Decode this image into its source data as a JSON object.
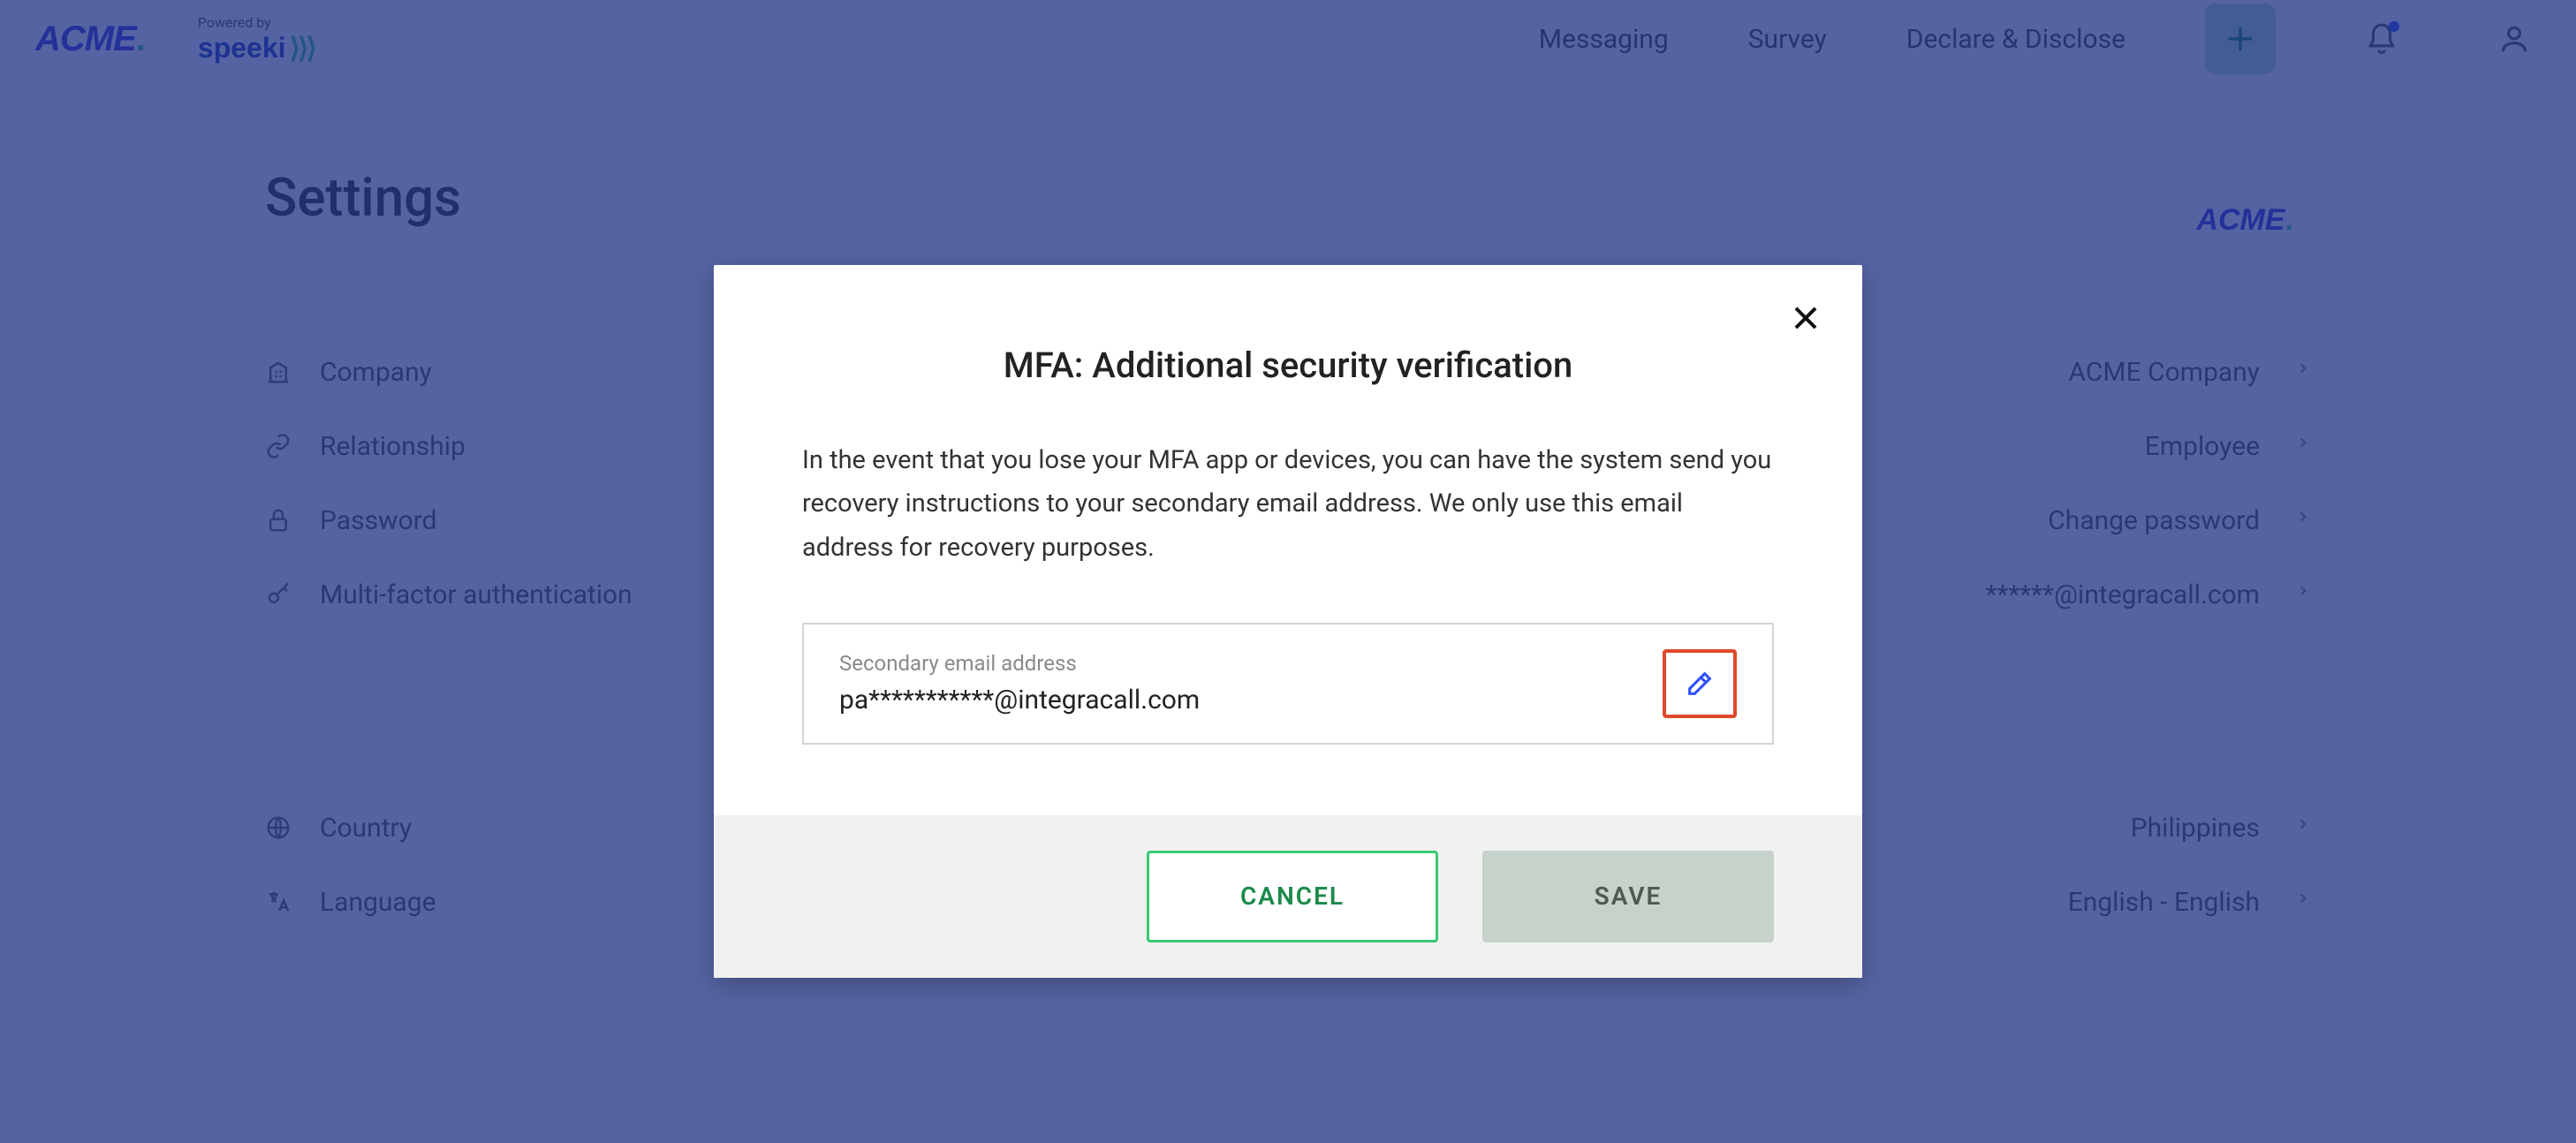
{
  "header": {
    "logo": "ACME",
    "powered_by": "Powered by",
    "speeki": "speeki",
    "nav": {
      "messaging": "Messaging",
      "survey": "Survey",
      "declare": "Declare & Disclose"
    }
  },
  "page": {
    "title": "Settings",
    "mini_logo": "ACME"
  },
  "settings": {
    "section1": [
      {
        "icon": "building",
        "label": "Company",
        "value": "ACME Company"
      },
      {
        "icon": "link",
        "label": "Relationship",
        "value": "Employee"
      },
      {
        "icon": "lock",
        "label": "Password",
        "value": "Change password"
      },
      {
        "icon": "key",
        "label": "Multi-factor authentication",
        "value": "******@integracall.com"
      }
    ],
    "section2": [
      {
        "icon": "globe",
        "label": "Country",
        "value": "Philippines"
      },
      {
        "icon": "translate",
        "label": "Language",
        "value": "English - English"
      }
    ]
  },
  "modal": {
    "title": "MFA: Additional security verification",
    "description": "In the event that you lose your MFA app or devices, you can have the system send you recovery instructions to your secondary email address. We only use this email address for recovery purposes.",
    "email_label": "Secondary email address",
    "email_value": "pa***********@integracall.com",
    "cancel": "CANCEL",
    "save": "SAVE"
  }
}
